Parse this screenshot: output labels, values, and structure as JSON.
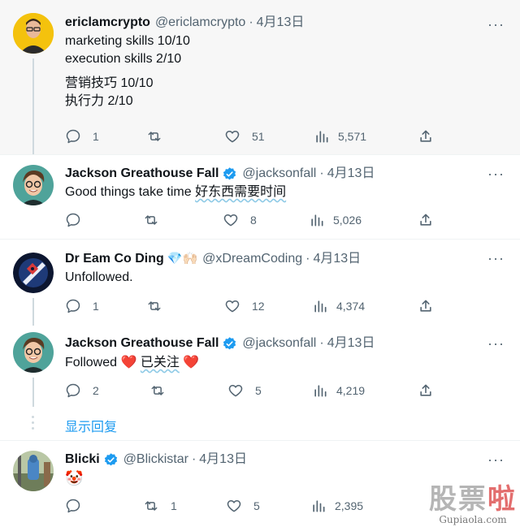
{
  "tweets": [
    {
      "name": "ericlamcrypto",
      "handle": "@ericlamcrypto",
      "time": "4月13日",
      "text_lines": [
        "marketing skills 10/10",
        "execution skills 2/10",
        "营销技巧 10/10",
        "执行力 2/10"
      ],
      "replies": "1",
      "retweets": "",
      "likes": "51",
      "views": "5,571"
    },
    {
      "name": "Jackson Greathouse Fall",
      "handle": "@jacksonfall",
      "time": "4月13日",
      "text_plain": "Good things take time ",
      "text_cn": "好东西需要时间",
      "replies": "",
      "retweets": "",
      "likes": "8",
      "views": "5,026"
    },
    {
      "name": "Dr Eam Co Ding",
      "badge_emoji": "💎🙌🏻",
      "handle": "@xDreamCoding",
      "time": "4月13日",
      "text": "Unfollowed.",
      "replies": "1",
      "retweets": "",
      "likes": "12",
      "views": "4,374"
    },
    {
      "name": "Jackson Greathouse Fall",
      "handle": "@jacksonfall",
      "time": "4月13日",
      "text_a": "Followed ",
      "text_b": "已关注",
      "heart": "❤️",
      "replies": "2",
      "retweets": "",
      "likes": "5",
      "views": "4,219"
    },
    {
      "name": "Blicki",
      "handle": "@Blickistar",
      "time": "4月13日",
      "text": "🤡",
      "replies": "",
      "retweets": "1",
      "likes": "5",
      "views": "2,395"
    }
  ],
  "show_replies": "显示回复",
  "separator": "·",
  "more_glyph": "···",
  "watermark": {
    "cn_a": "股票",
    "cn_b": "啦",
    "url": "Gupiaola.com"
  },
  "colors": {
    "verified": "#1d9bf0",
    "link": "#1d9bf0",
    "muted": "#536471",
    "highlight_bg": "#f7f7f7"
  }
}
